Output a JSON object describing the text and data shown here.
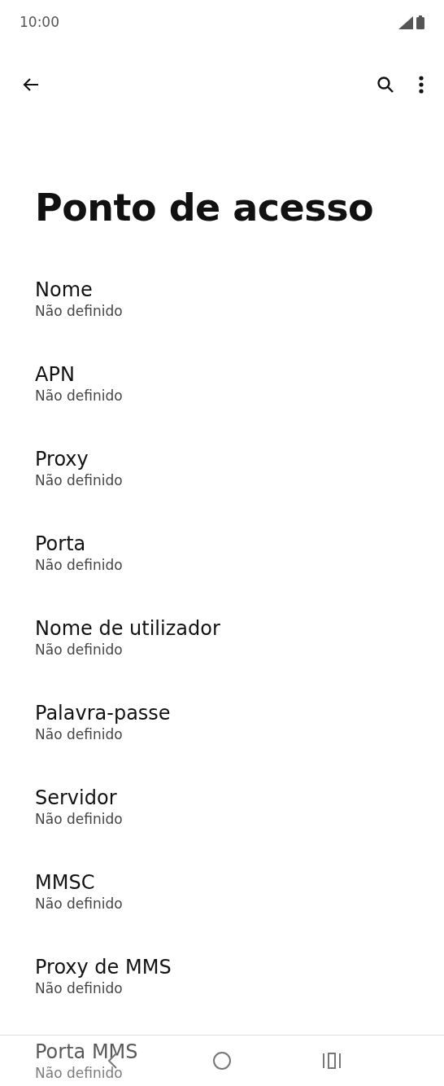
{
  "status_bar": {
    "time": "10:00"
  },
  "title": "Ponto de acesso",
  "items": [
    {
      "title": "Nome",
      "value": "Não definido"
    },
    {
      "title": "APN",
      "value": "Não definido"
    },
    {
      "title": "Proxy",
      "value": "Não definido"
    },
    {
      "title": "Porta",
      "value": "Não definido"
    },
    {
      "title": "Nome de utilizador",
      "value": "Não definido"
    },
    {
      "title": "Palavra-passe",
      "value": "Não definido"
    },
    {
      "title": "Servidor",
      "value": "Não definido"
    },
    {
      "title": "MMSC",
      "value": "Não definido"
    },
    {
      "title": "Proxy de MMS",
      "value": "Não definido"
    },
    {
      "title": "Porta MMS",
      "value": "Não definido"
    }
  ]
}
